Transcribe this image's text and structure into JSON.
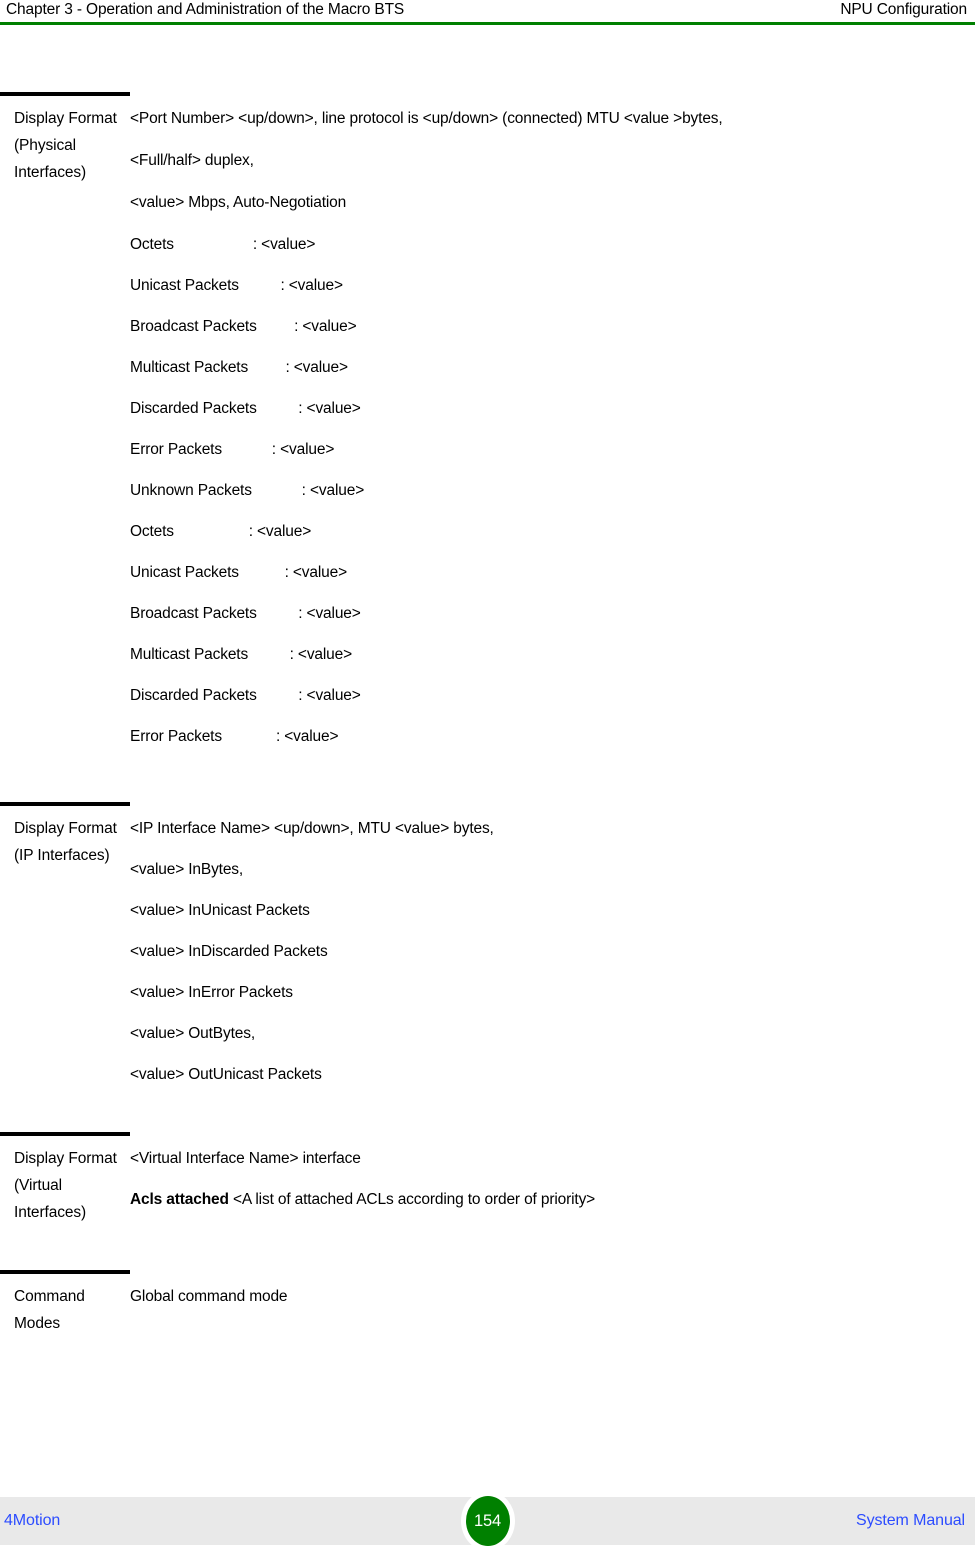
{
  "header": {
    "left": "Chapter 3 - Operation and Administration of the Macro BTS",
    "right": "NPU Configuration",
    "rule_color": "#008000"
  },
  "table": {
    "rows": [
      {
        "term": "Display Format (Physical Interfaces)",
        "lines": [
          "<Port Number> <up/down>, line protocol is <up/down> (connected) MTU <value >bytes,",
          "<Full/half> duplex,",
          "<value> Mbps, Auto-Negotiation",
          "Octets                   : <value>",
          "Unicast Packets          : <value>",
          "Broadcast Packets         : <value>",
          "Multicast Packets         : <value>",
          "Discarded Packets          : <value>",
          "Error Packets            : <value>",
          "Unknown Packets            : <value>",
          "Octets                  : <value>",
          "Unicast Packets           : <value>",
          "Broadcast Packets          : <value>",
          "Multicast Packets          : <value>",
          "Discarded Packets          : <value>",
          "Error Packets             : <value>"
        ]
      },
      {
        "term": "Display Format (IP Interfaces)",
        "lines": [
          "<IP Interface Name> <up/down>, MTU <value> bytes,",
          "<value> InBytes,",
          "<value> InUnicast Packets",
          "<value> InDiscarded Packets",
          "<value> InError Packets",
          "<value> OutBytes,",
          "<value> OutUnicast Packets"
        ]
      },
      {
        "term": "Display Format (Virtual Interfaces)",
        "lines": [
          "<Virtual Interface Name> interface",
          "Acls attached <A list of attached ACLs according to order of priority>"
        ],
        "bold_lead": "Acls attached"
      },
      {
        "term": "Command Modes",
        "lines": [
          "Global command mode"
        ]
      }
    ]
  },
  "footer": {
    "left": "4Motion",
    "page_number": "154",
    "right": "System Manual",
    "badge_color": "#008000",
    "link_color": "#2c4cff",
    "band_color": "#e9e9e9"
  }
}
